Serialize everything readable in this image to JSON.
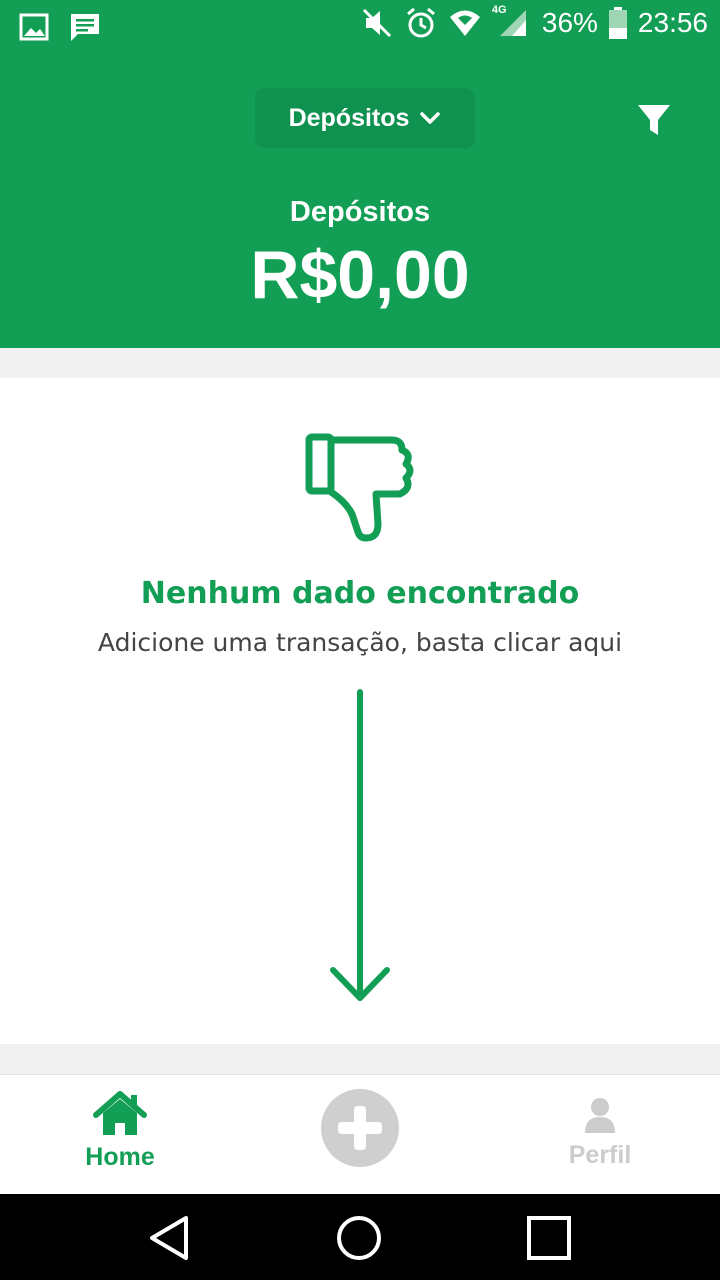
{
  "status_bar": {
    "left_icons": [
      "image-icon",
      "message-icon"
    ],
    "right_icons": [
      "mute-icon",
      "alarm-icon",
      "wifi-icon",
      "cell-signal-icon",
      "battery-icon"
    ],
    "network": "4G",
    "battery": "36%",
    "time": "23:56"
  },
  "header": {
    "dropdown_label": "Depósitos",
    "filter_icon": "filter-icon",
    "summary_label": "Depósitos",
    "summary_amount": "R$0,00"
  },
  "empty_state": {
    "icon": "thumbs-down-icon",
    "title": "Nenhum dado encontrado",
    "subtitle": "Adicione uma transação, basta clicar aqui",
    "arrow_icon": "arrow-down-icon"
  },
  "bottom_nav": {
    "home_label": "Home",
    "add_icon": "plus-icon",
    "profile_label": "Perfil"
  },
  "system_nav": [
    "back-icon",
    "home-circle-icon",
    "recents-icon"
  ],
  "colors": {
    "brand_green": "#129e55",
    "dropdown_green": "#0f9150",
    "inactive_gray": "#cccccc"
  }
}
